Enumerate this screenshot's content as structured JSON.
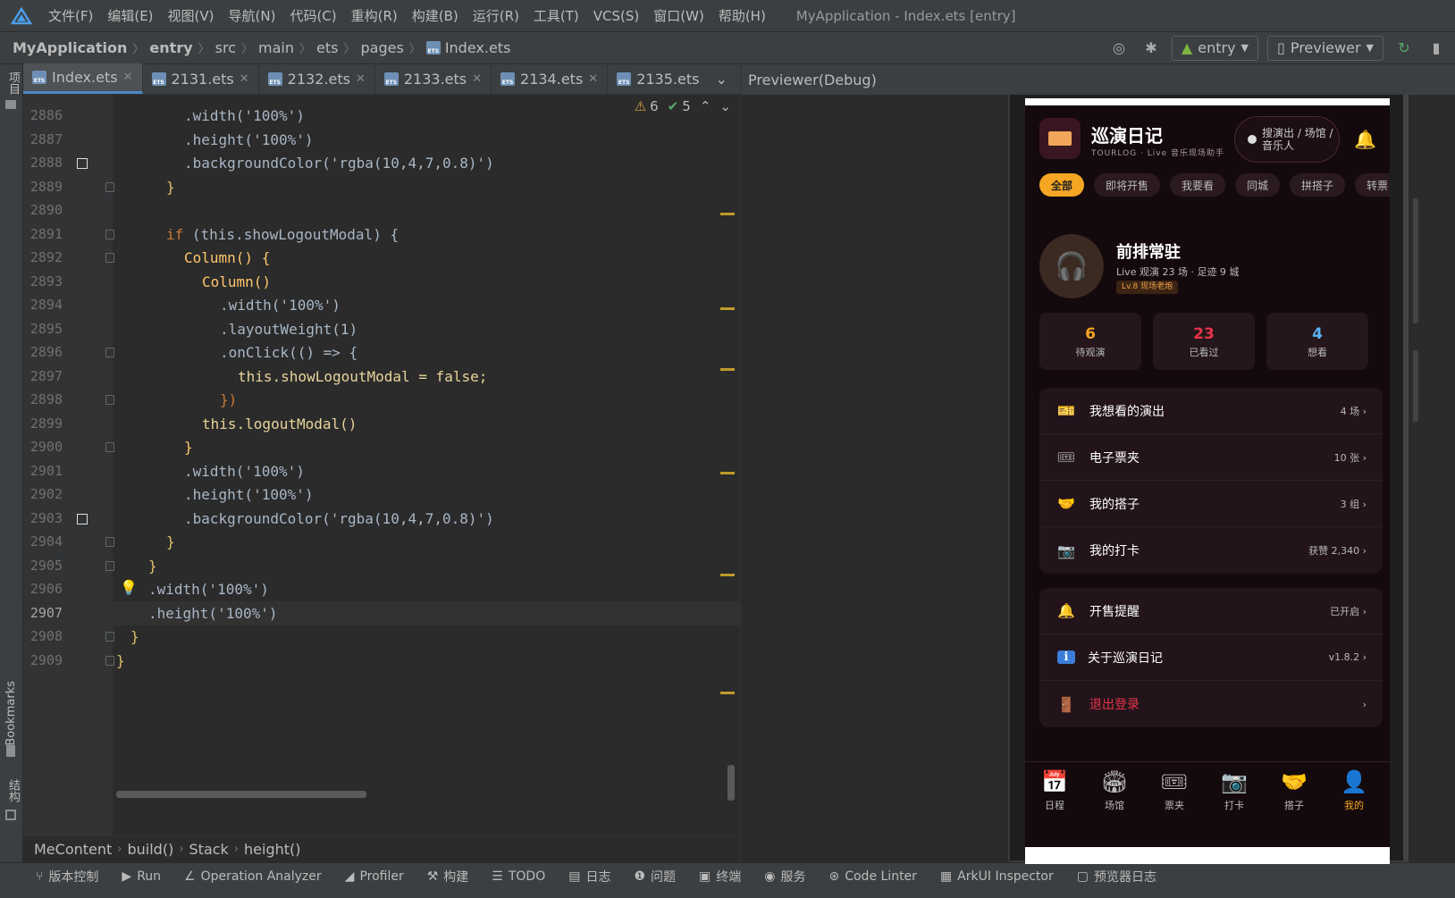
{
  "menubar": {
    "items": [
      "文件(F)",
      "编辑(E)",
      "视图(V)",
      "导航(N)",
      "代码(C)",
      "重构(R)",
      "构建(B)",
      "运行(R)",
      "工具(T)",
      "VCS(S)",
      "窗口(W)",
      "帮助(H)"
    ],
    "window_title": "MyApplication - Index.ets [entry]"
  },
  "navbar": {
    "crumbs": [
      "MyApplication",
      "entry",
      "src",
      "main",
      "ets",
      "pages",
      "Index.ets"
    ],
    "module_select": "entry",
    "previewer_select": "Previewer"
  },
  "leftstrip": {
    "project": "项目",
    "bookmarks": "Bookmarks",
    "structure": "结构"
  },
  "tabs": [
    {
      "label": "Index.ets",
      "active": true
    },
    {
      "label": "2131.ets"
    },
    {
      "label": "2132.ets"
    },
    {
      "label": "2133.ets"
    },
    {
      "label": "2134.ets"
    },
    {
      "label": "2135.ets"
    }
  ],
  "warnings": {
    "warn": "6",
    "ok": "5"
  },
  "code_lines": [
    {
      "n": "2886"
    },
    {
      "n": "2887"
    },
    {
      "n": "2888"
    },
    {
      "n": "2889"
    },
    {
      "n": "2890"
    },
    {
      "n": "2891"
    },
    {
      "n": "2892"
    },
    {
      "n": "2893"
    },
    {
      "n": "2894"
    },
    {
      "n": "2895"
    },
    {
      "n": "2896"
    },
    {
      "n": "2897"
    },
    {
      "n": "2898"
    },
    {
      "n": "2899"
    },
    {
      "n": "2900"
    },
    {
      "n": "2901"
    },
    {
      "n": "2902"
    },
    {
      "n": "2903"
    },
    {
      "n": "2904"
    },
    {
      "n": "2905"
    },
    {
      "n": "2906"
    },
    {
      "n": "2907"
    },
    {
      "n": "2908"
    },
    {
      "n": "2909"
    }
  ],
  "code_text": {
    "l2886": ".width('100%')",
    "l2887": ".height('100%')",
    "l2888": ".backgroundColor('rgba(10,4,7,0.8)')",
    "l2889": "}",
    "l2891_kw": "if",
    "l2891": " (this.showLogoutModal) {",
    "l2892": "Column() {",
    "l2893": "Column()",
    "l2894": ".width('100%')",
    "l2895": ".layoutWeight(1)",
    "l2896": ".onClick(() => {",
    "l2897": "this.showLogoutModal = false;",
    "l2898": "})",
    "l2899": "this.logoutModal()",
    "l2900": "}",
    "l2901": ".width('100%')",
    "l2902": ".height('100%')",
    "l2903": ".backgroundColor('rgba(10,4,7,0.8)')",
    "l2904": "}",
    "l2905": "}",
    "l2906": ".width('100%')",
    "l2907": ".height('100%')",
    "l2908": "}",
    "l2909": "}"
  },
  "editor_crumbs": [
    "MeContent",
    "build()",
    "Stack",
    "height()"
  ],
  "bottom_tools": [
    "版本控制",
    "Run",
    "Operation Analyzer",
    "Profiler",
    "构建",
    "TODO",
    "日志",
    "问题",
    "终端",
    "服务",
    "Code Linter",
    "ArkUI Inspector",
    "预览器日志"
  ],
  "previewer": {
    "title": "Previewer(Debug)"
  },
  "app": {
    "title": "巡演日记",
    "subtitle": "TOURLOG · Live 音乐现场助手",
    "search": "搜演出 / 场馆 / 音乐人",
    "chips": [
      "全部",
      "即将开售",
      "我要看",
      "同城",
      "拼搭子",
      "转票"
    ],
    "user_name": "前排常驻",
    "user_stat": "Live 观演 23 场 · 足迹 9 城",
    "user_badge": "Lv.8 现场老炮",
    "stats": [
      {
        "num": "6",
        "label": "待观演",
        "color": "#f5a623"
      },
      {
        "num": "23",
        "label": "已看过",
        "color": "#e8334a"
      },
      {
        "num": "4",
        "label": "想看",
        "color": "#5ab2f0"
      }
    ],
    "menu1": [
      {
        "icon": "🎫",
        "label": "我想看的演出",
        "value": "4 场 ›"
      },
      {
        "icon": "🎟",
        "label": "电子票夹",
        "value": "10 张 ›"
      },
      {
        "icon": "🤝",
        "label": "我的搭子",
        "value": "3 组 ›"
      },
      {
        "icon": "📷",
        "label": "我的打卡",
        "value": "获赞 2,340 ›"
      }
    ],
    "menu2": [
      {
        "icon": "🔔",
        "label": "开售提醒",
        "value": "已开启 ›"
      },
      {
        "icon": "ℹ",
        "label": "关于巡演日记",
        "value": "v1.8.2 ›"
      },
      {
        "icon": "🚪",
        "label": "退出登录",
        "value": "›"
      }
    ],
    "tabs": [
      {
        "icon": "📅",
        "label": "日程"
      },
      {
        "icon": "🏟",
        "label": "场馆"
      },
      {
        "icon": "🎟",
        "label": "票夹"
      },
      {
        "icon": "📷",
        "label": "打卡"
      },
      {
        "icon": "🤝",
        "label": "搭子"
      },
      {
        "icon": "👤",
        "label": "我的",
        "active": true
      }
    ]
  },
  "colors": {
    "accent": "#f5a623",
    "danger": "#e8334a",
    "info": "#5ab2f0"
  }
}
